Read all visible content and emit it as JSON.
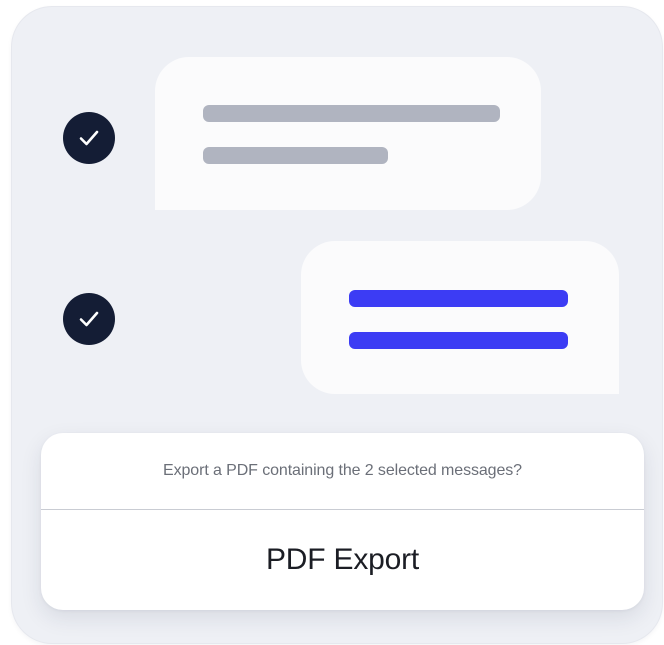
{
  "dialog": {
    "prompt": "Export a PDF containing the 2 selected messages?",
    "action_label": "PDF Export"
  },
  "messages": [
    {
      "selected": true,
      "side": "incoming",
      "bar_color": "#b0b4c0",
      "icon": "checkmark-circle-icon"
    },
    {
      "selected": true,
      "side": "outgoing",
      "bar_color": "#3c3cf4",
      "icon": "checkmark-circle-icon"
    }
  ],
  "colors": {
    "background": "#eef0f5",
    "bubble": "#fbfbfc",
    "check_fill": "#141d35",
    "accent": "#3c3cf4",
    "placeholder_bar": "#b0b4c0"
  }
}
